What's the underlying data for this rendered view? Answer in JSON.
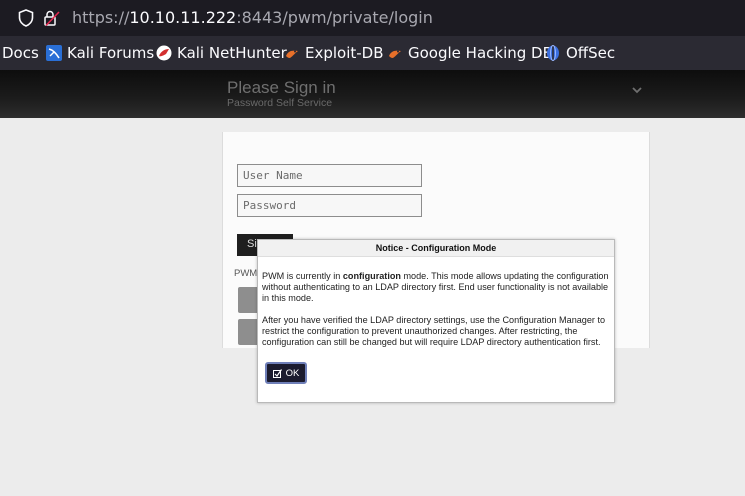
{
  "browser": {
    "url_prefix": "https://",
    "url_host": "10.10.11.222",
    "url_rest": ":8443/pwm/private/login"
  },
  "bookmarks": [
    {
      "label": "Docs"
    },
    {
      "label": "Kali Forums",
      "icon": "kali-icon"
    },
    {
      "label": "Kali NetHunter",
      "icon": "nethunter-icon"
    },
    {
      "label": "Exploit-DB",
      "icon": "exploit-db-icon"
    },
    {
      "label": "Google Hacking DB",
      "icon": "ghdb-icon"
    },
    {
      "label": "OffSec",
      "icon": "offsec-icon"
    }
  ],
  "header": {
    "title": "Please Sign in",
    "subtitle": "Password Self Service"
  },
  "login": {
    "username_placeholder": "User Name",
    "password_placeholder": "Password",
    "signin_label": "Sign in",
    "pwm_label": "PWM"
  },
  "modal": {
    "title": "Notice - Configuration Mode",
    "p1_before": "PWM is currently in ",
    "p1_bold": "configuration",
    "p1_after": " mode. This mode allows updating the configuration without authenticating to an LDAP directory first. End user functionality is not available in this mode.",
    "p2": "After you have verified the LDAP directory settings, use the Configuration Manager to restrict the configuration to prevent unauthorized changes. After restricting, the configuration can still be changed but will require LDAP directory authentication first.",
    "ok_label": "OK"
  }
}
